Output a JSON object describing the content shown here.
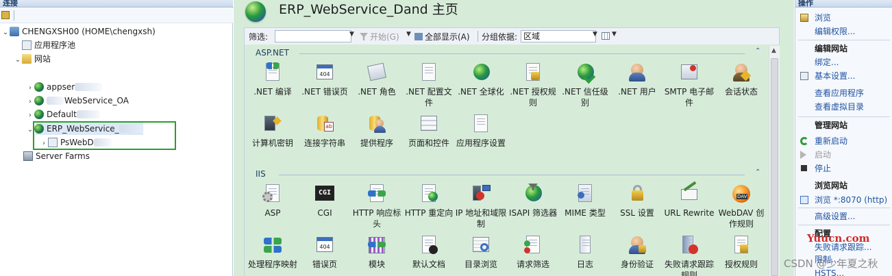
{
  "left": {
    "pane_title": "连接",
    "tree": {
      "server": "CHENGXSH00 (HOME\\chengxsh)",
      "app_pools": "应用程序池",
      "sites": "网站",
      "site1": "appser",
      "site2": "WebService_OA",
      "site3": "Default",
      "site_selected": "ERP_WebService_",
      "child": "PsWebD",
      "farms": "Server Farms"
    }
  },
  "main": {
    "title": "ERP_WebService_Dand 主页",
    "filter": {
      "label": "筛选:",
      "value": "",
      "start": "开始(G)",
      "show_all": "全部显示(A)",
      "group_label": "分组依据:",
      "group_value": "区域"
    },
    "groups": [
      {
        "title": "ASP.NET",
        "items": [
          ".NET 编译",
          ".NET 错误页",
          ".NET 角色",
          ".NET 配置文件",
          ".NET 全球化",
          ".NET 授权规则",
          ".NET 信任级别",
          ".NET 用户",
          "SMTP 电子邮件",
          "会话状态",
          "计算机密钥",
          "连接字符串",
          "提供程序",
          "页面和控件",
          "应用程序设置"
        ]
      },
      {
        "title": "IIS",
        "items": [
          "ASP",
          "CGI",
          "HTTP 响应标头",
          "HTTP 重定向",
          "IP 地址和域限制",
          "ISAPI 筛选器",
          "MIME 类型",
          "SSL 设置",
          "URL Rewrite",
          "WebDAV 创作规则",
          "处理程序映射",
          "错误页",
          "模块",
          "默认文档",
          "目录浏览",
          "请求筛选",
          "日志",
          "身份验证",
          "失败请求跟踪规则",
          "授权规则"
        ]
      }
    ]
  },
  "actions": {
    "pane_title": "操作",
    "browse": "浏览",
    "edit_perms": "编辑权限...",
    "edit_site_h": "编辑网站",
    "bindings": "绑定...",
    "basic_settings": "基本设置...",
    "view_apps": "查看应用程序",
    "view_vdirs": "查看虚拟目录",
    "manage_site_h": "管理网站",
    "restart": "重新启动",
    "start": "启动",
    "stop": "停止",
    "browse_site_h": "浏览网站",
    "browse_8070": "浏览 *:8070 (http)",
    "advanced": "高级设置...",
    "config_h": "配置",
    "failed_tracing": "失败请求跟踪...",
    "limits": "限制...",
    "hsts": "HSTS..."
  },
  "watermark": {
    "site": "Yuucn.com",
    "csdn": "CSDN @少年夏之秋"
  },
  "colors": {
    "feature_bg": "#d6ecd9",
    "link": "#2153a3",
    "selection_outline": "#2a9d2a"
  }
}
